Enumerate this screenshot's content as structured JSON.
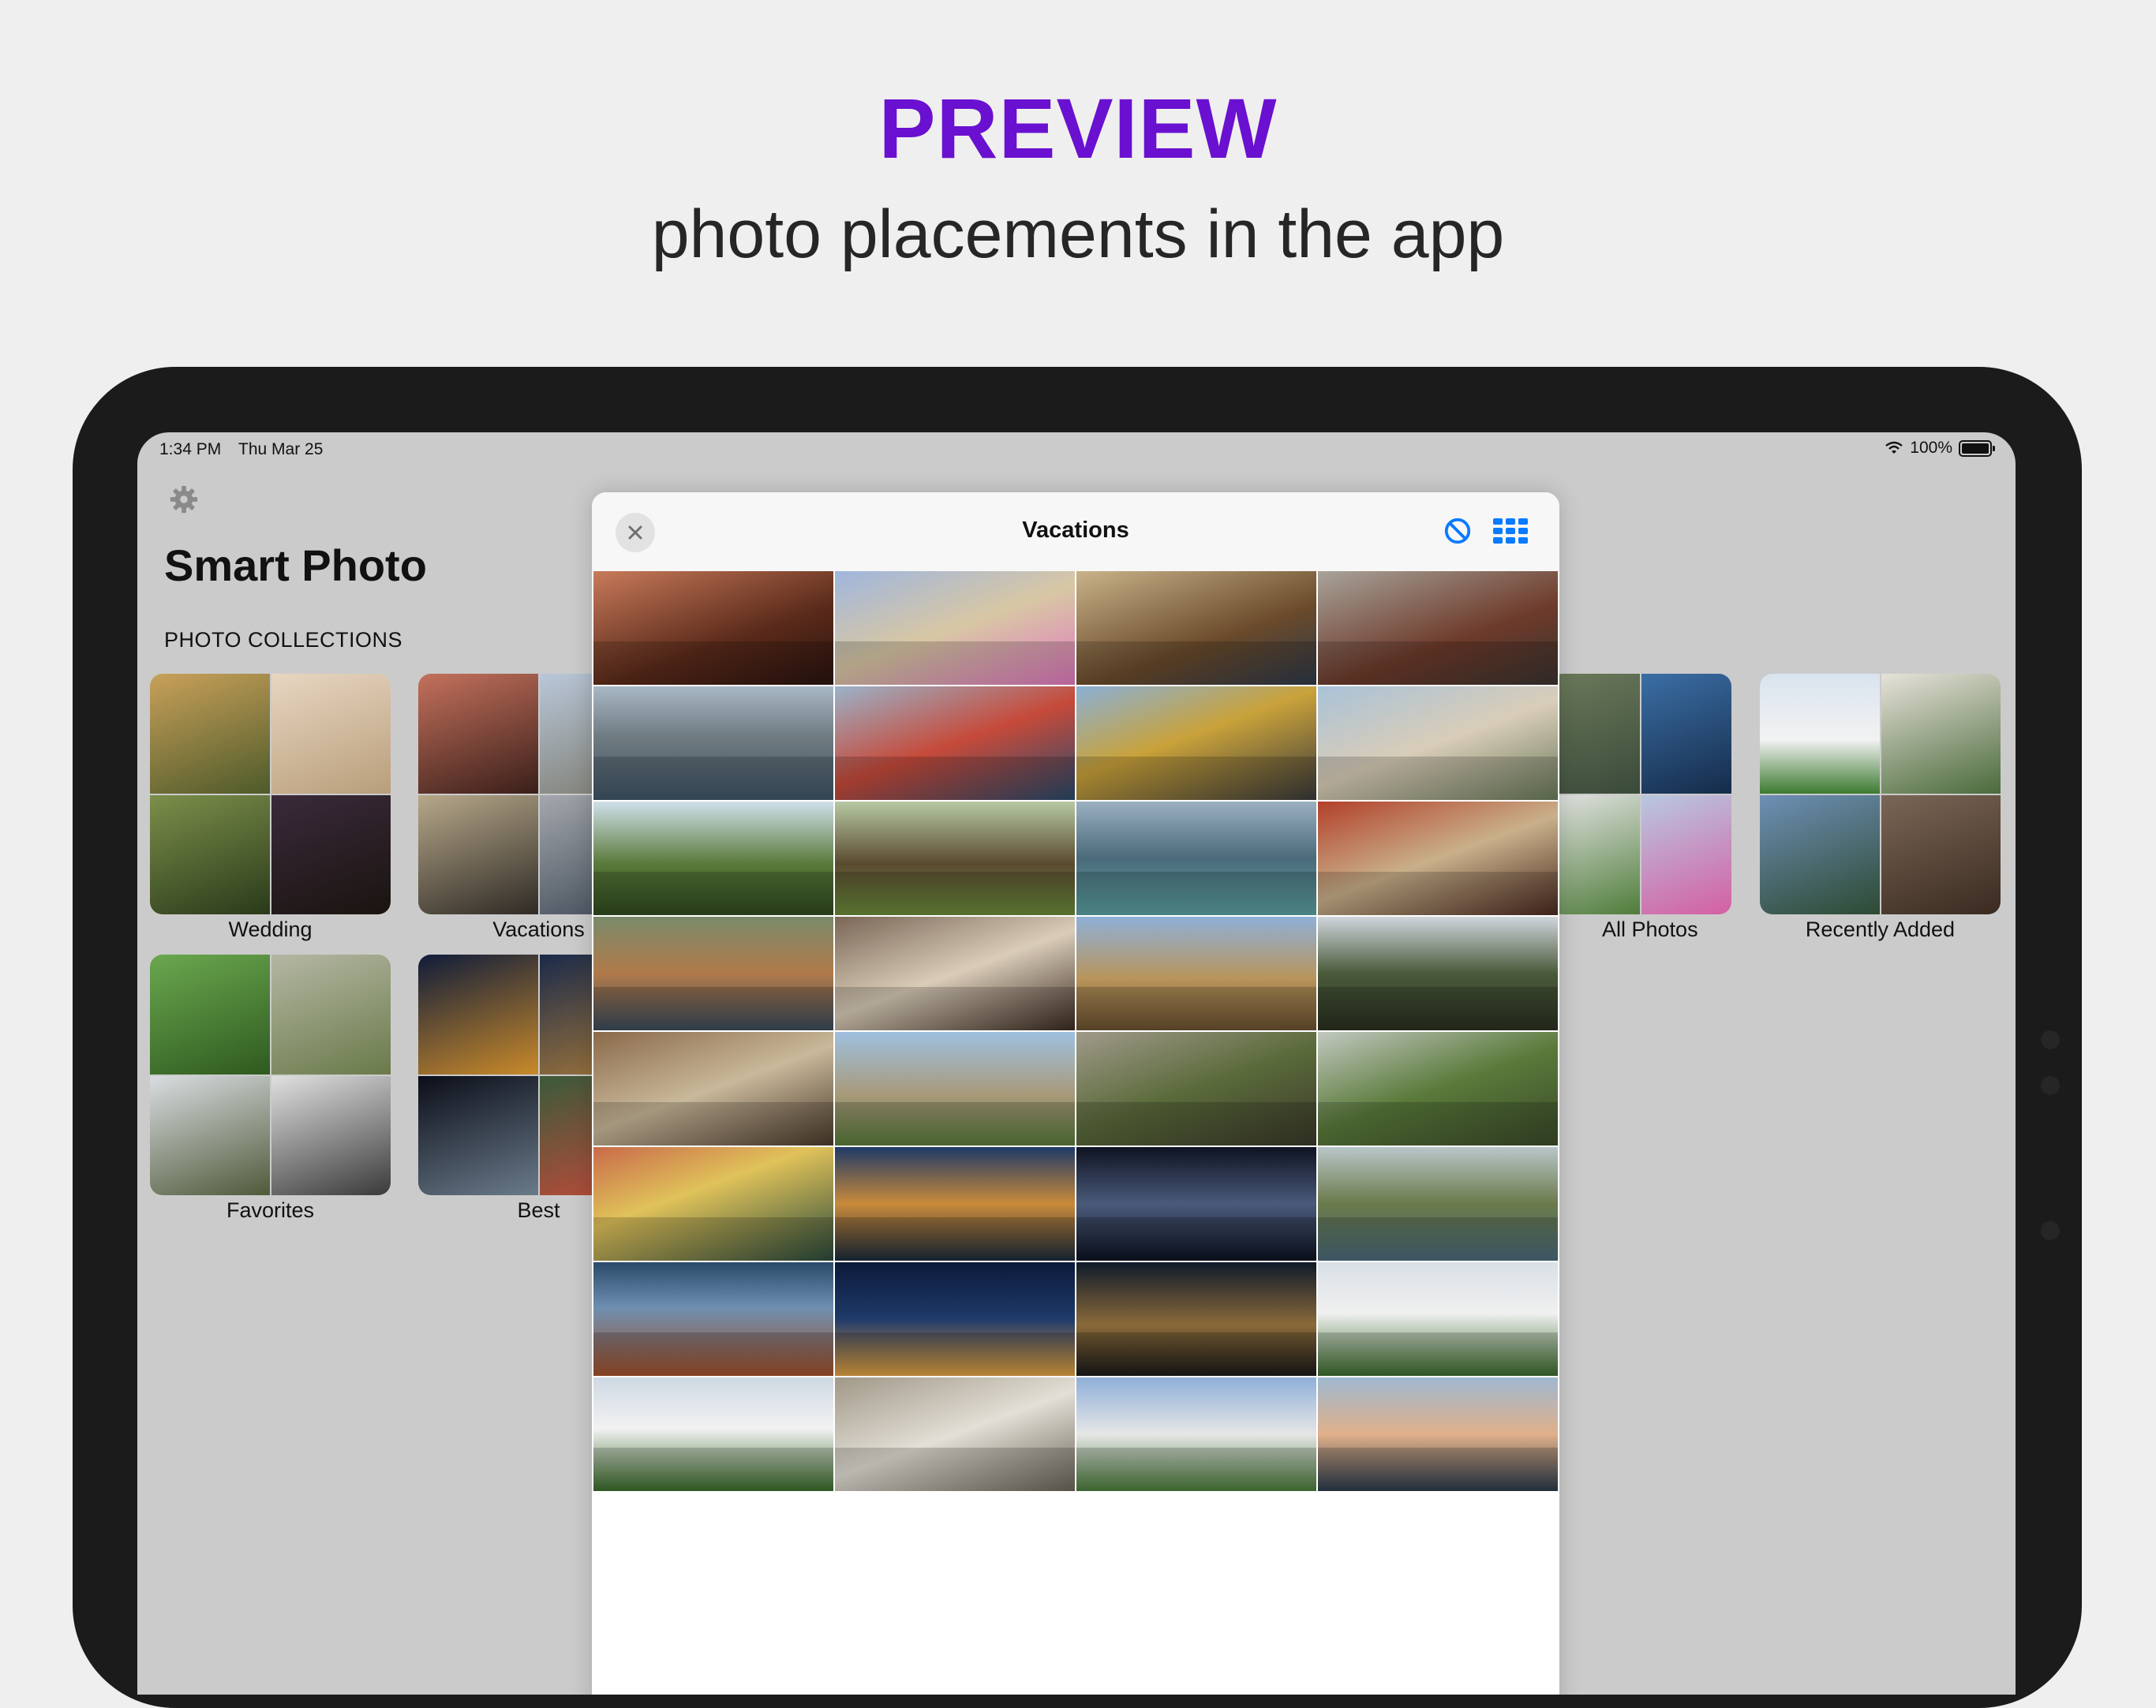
{
  "hero": {
    "title": "PREVIEW",
    "subtitle": "photo placements in the app"
  },
  "status_bar": {
    "time": "1:34 PM",
    "date": "Thu Mar 25",
    "battery": "100%"
  },
  "app": {
    "title": "Smart Photo",
    "section_label": "PHOTO COLLECTIONS"
  },
  "albums": [
    {
      "name": "Wedding"
    },
    {
      "name": "Vacations"
    },
    {
      "name": "All Photos"
    },
    {
      "name": "Recently Added"
    },
    {
      "name": "Favorites"
    },
    {
      "name": "Best"
    }
  ],
  "modal": {
    "title": "Vacations"
  },
  "colors": {
    "accent": "#6a10d0",
    "ios_blue": "#0a7aff"
  },
  "icons": [
    "gear-icon",
    "close-icon",
    "ban-icon",
    "grid-icon",
    "wifi-icon",
    "battery-icon"
  ]
}
